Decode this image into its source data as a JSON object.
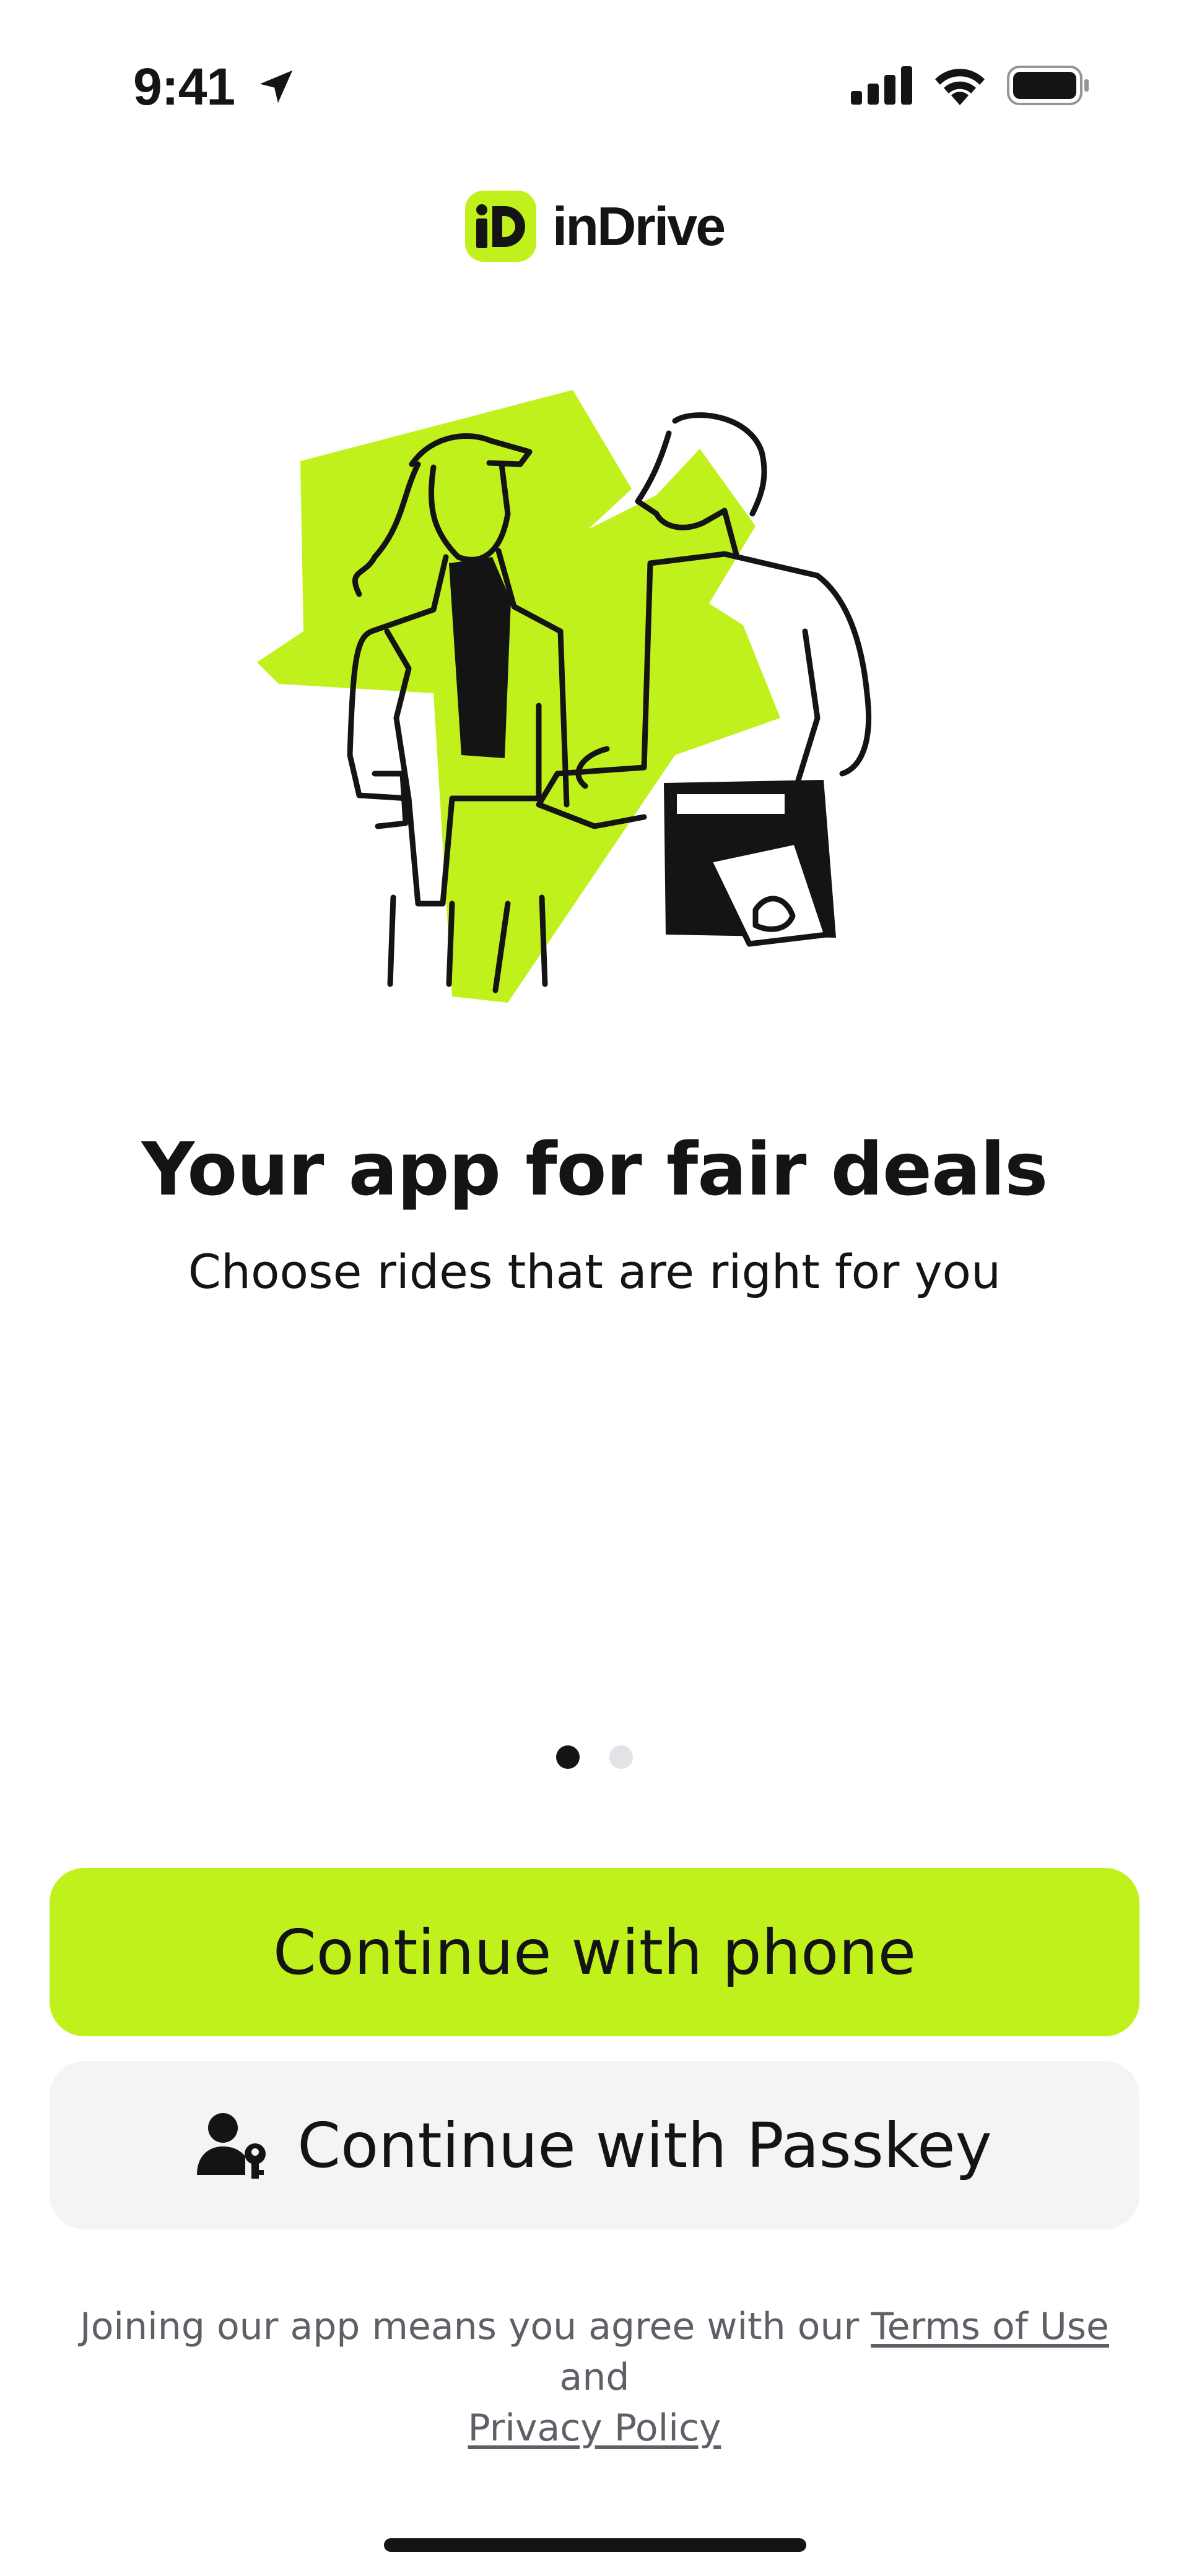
{
  "status_bar": {
    "time": "9:41",
    "icons": [
      "location-arrow-icon",
      "signal-icon",
      "wifi-icon",
      "battery-icon"
    ]
  },
  "brand": {
    "name": "inDrive",
    "logo_icon": "indrive-logo-icon",
    "accent_color": "#c1f11d"
  },
  "onboarding": {
    "illustration": "handshake-illustration",
    "title": "Your app for fair deals",
    "subtitle": "Choose rides that are right for you",
    "page_count": 2,
    "active_page": 1
  },
  "actions": {
    "phone_label": "Continue with phone",
    "passkey_label": "Continue with Passkey",
    "passkey_icon": "passkey-user-icon"
  },
  "legal": {
    "prefix": "Joining our app means you agree with our ",
    "terms_label": "Terms of Use",
    "middle": " and ",
    "privacy_label": "Privacy Policy"
  },
  "colors": {
    "primary_button": "#c1f11d",
    "secondary_button": "#f3f4f6",
    "text": "#141414",
    "muted_text": "#5d6066"
  }
}
